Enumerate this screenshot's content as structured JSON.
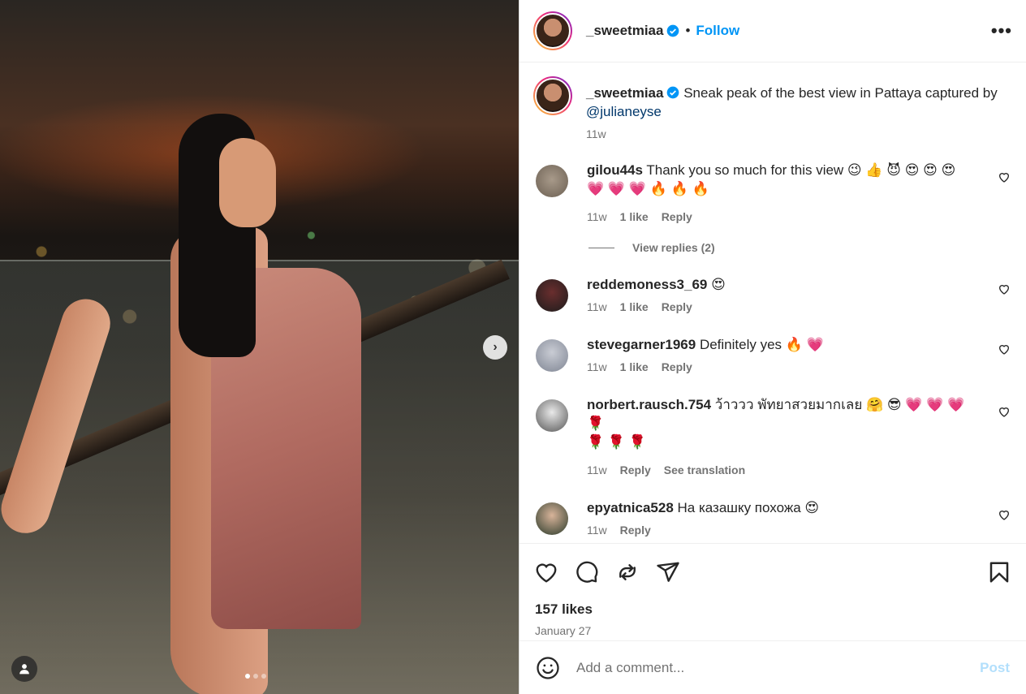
{
  "post": {
    "username": "_sweetmiaa",
    "follow_label": "Follow",
    "separator": "•",
    "more_label": "•••",
    "media_next_label": "›",
    "caption": {
      "text": "Sneak peak of the best view in Pattaya captured by",
      "mention": "@julianeyse",
      "age": "11w"
    },
    "comments": [
      {
        "user": "gilou44s",
        "text": "Thank you so much for this view 😉 👍 😈 😍 😍 😍",
        "text2": "💗 💗 💗 🔥 🔥 🔥",
        "age": "11w",
        "likes": "1 like",
        "reply": "Reply",
        "view_replies": "View replies (2)"
      },
      {
        "user": "reddemoness3_69",
        "text": "😍",
        "age": "11w",
        "likes": "1 like",
        "reply": "Reply"
      },
      {
        "user": "stevegarner1969",
        "text": "Definitely yes 🔥 💗",
        "age": "11w",
        "likes": "1 like",
        "reply": "Reply"
      },
      {
        "user": "norbert.rausch.754",
        "text": "ว้าววว พัทยาสวยมากเลย 🤗 😎 💗 💗 💗 🌹",
        "text2": "🌹 🌹 🌹",
        "age": "11w",
        "reply": "Reply",
        "translate": "See translation"
      },
      {
        "user": "epyatnica528",
        "text": "На казашку похожа 😍",
        "age": "11w",
        "reply": "Reply"
      }
    ],
    "likes_count": "157 likes",
    "date": "January 27",
    "add_comment_placeholder": "Add a comment...",
    "post_label": "Post"
  },
  "colors": {
    "accent": "#0095f6",
    "post_disabled": "#b2dffc",
    "muted": "#737373"
  }
}
